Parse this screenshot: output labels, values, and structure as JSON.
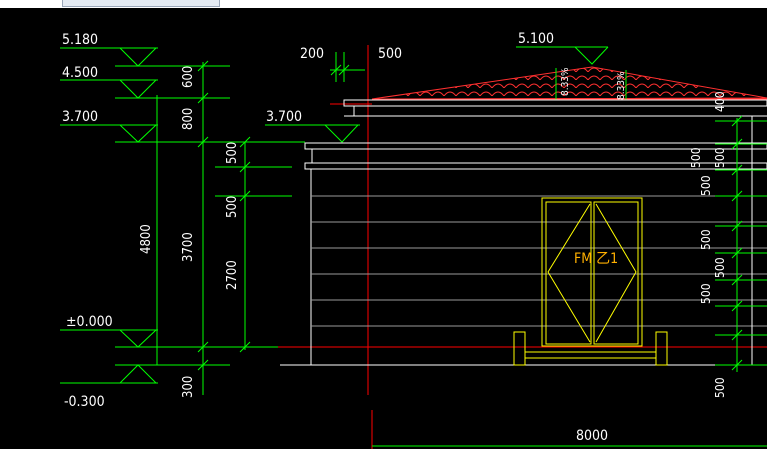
{
  "drawing": {
    "elevation_labels": [
      "5.180",
      "4.500",
      "3.700",
      "±0.000",
      "-0.300"
    ],
    "ridge_elevation": "5.100",
    "eave_elevation": "3.700",
    "vertical_dims_outer": [
      "600",
      "800",
      "300"
    ],
    "total_height_dim": "4800",
    "wall_height_dim": "3700",
    "inner_dims": [
      "500",
      "500",
      "2700"
    ],
    "top_dims": [
      "200",
      "500"
    ],
    "right_dims": [
      "400",
      "500",
      "500",
      "500",
      "500",
      "500",
      "500",
      "500"
    ],
    "bottom_width_dim": "8000",
    "door_label": "FM 乙1",
    "roof_slope_label": "8.33%"
  },
  "colors": {
    "background": "#000000",
    "dimension": "#00ff00",
    "text": "#ffffff",
    "axis": "#ff0000",
    "roof_tiles": "#ff3030",
    "door": "#ffff00",
    "door_label": "#ffb000",
    "building": "#ffffff"
  }
}
